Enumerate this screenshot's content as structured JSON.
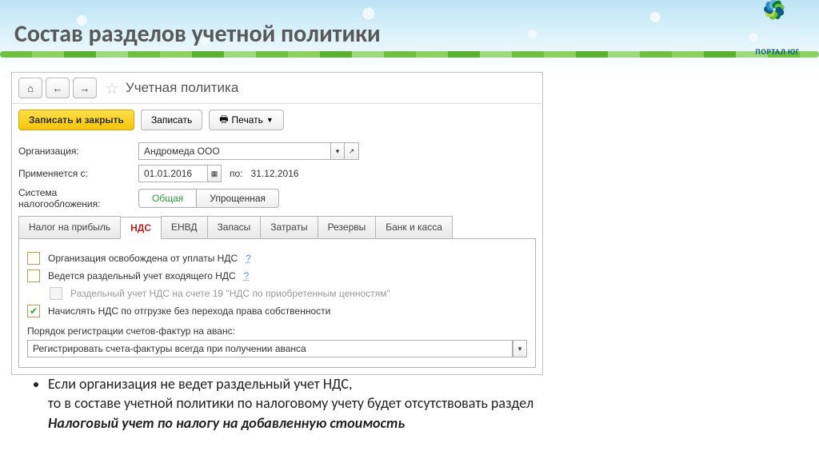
{
  "slide": {
    "title": "Состав разделов учетной политики"
  },
  "logo": {
    "text": "ПОРТАЛ ЮГ"
  },
  "window": {
    "title": "Учетная политика",
    "nav": {
      "home": "⌂",
      "back": "←",
      "fwd": "→"
    },
    "toolbar": {
      "save_close": "Записать и закрыть",
      "save": "Записать",
      "print": "Печать"
    },
    "form": {
      "org_label": "Организация:",
      "org_value": "Андромеда ООО",
      "from_label": "Применяется с:",
      "from_value": "01.01.2016",
      "to_label": "по:",
      "to_value": "31.12.2016",
      "tax_label": "Система налогообложения:",
      "tax_general": "Общая",
      "tax_simplified": "Упрощенная"
    },
    "tabs": {
      "t0": "Налог на прибыль",
      "t1": "НДС",
      "t2": "ЕНВД",
      "t3": "Запасы",
      "t4": "Затраты",
      "t5": "Резервы",
      "t6": "Банк и касса"
    },
    "nds": {
      "chk1": "Организация освобождена от уплаты НДС",
      "chk2": "Ведется раздельный учет входящего НДС",
      "chk2a": "Раздельный учет НДС на счете 19 \"НДС по приобретенным ценностям\"",
      "chk3": "Начислять НДС по отгрузке без перехода права собственности",
      "invoice_label": "Порядок регистрации счетов-фактур на аванс:",
      "invoice_value": "Регистрировать счета-фактуры всегда при получении аванса"
    },
    "help": "?"
  },
  "bullet": {
    "line1": "Если организация не ведет раздельный учет НДС,",
    "line2": "то в составе учетной политики по налоговому учету будет отсутствовать раздел",
    "line3": "Налоговый учет по налогу на добавленную стоимость"
  }
}
